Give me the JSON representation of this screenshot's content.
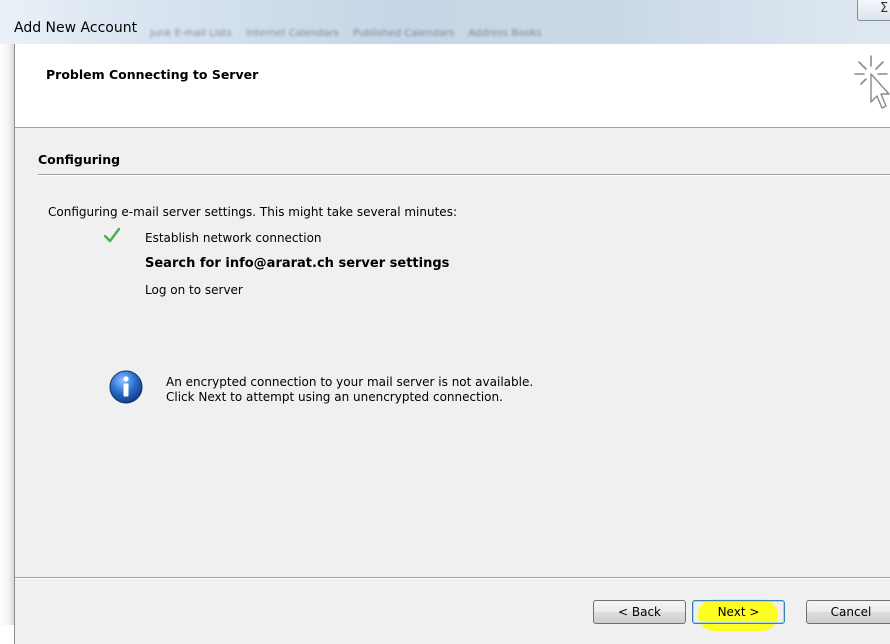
{
  "window": {
    "title": "Add New Account",
    "close_glyph": "Σ",
    "background_tabs": [
      "Junk E-mail Lists",
      "Internet Calendars",
      "Published Calendars",
      "Address Books"
    ]
  },
  "header": {
    "title": "Problem Connecting to Server",
    "icon": "cursor-sparkle-icon"
  },
  "section": {
    "title": "Configuring",
    "intro": "Configuring e-mail server settings. This might take several minutes:",
    "steps": [
      {
        "label": "Establish network connection",
        "status": "done",
        "icon": "checkmark-icon"
      },
      {
        "label": "Search for info@ararat.ch server settings",
        "status": "in-progress"
      },
      {
        "label": "Log on to server",
        "status": "pending"
      }
    ]
  },
  "info": {
    "icon": "info-icon",
    "line1": "An encrypted connection to your mail server is not available.",
    "line2": "Click Next to attempt using an unencrypted connection."
  },
  "buttons": {
    "back": "< Back",
    "next": "Next >",
    "cancel": "Cancel"
  },
  "colors": {
    "check": "#4caf50",
    "info_blue": "#1f5fb4",
    "highlight": "#ffff00",
    "dialog_bg": "#f0f0f0"
  }
}
